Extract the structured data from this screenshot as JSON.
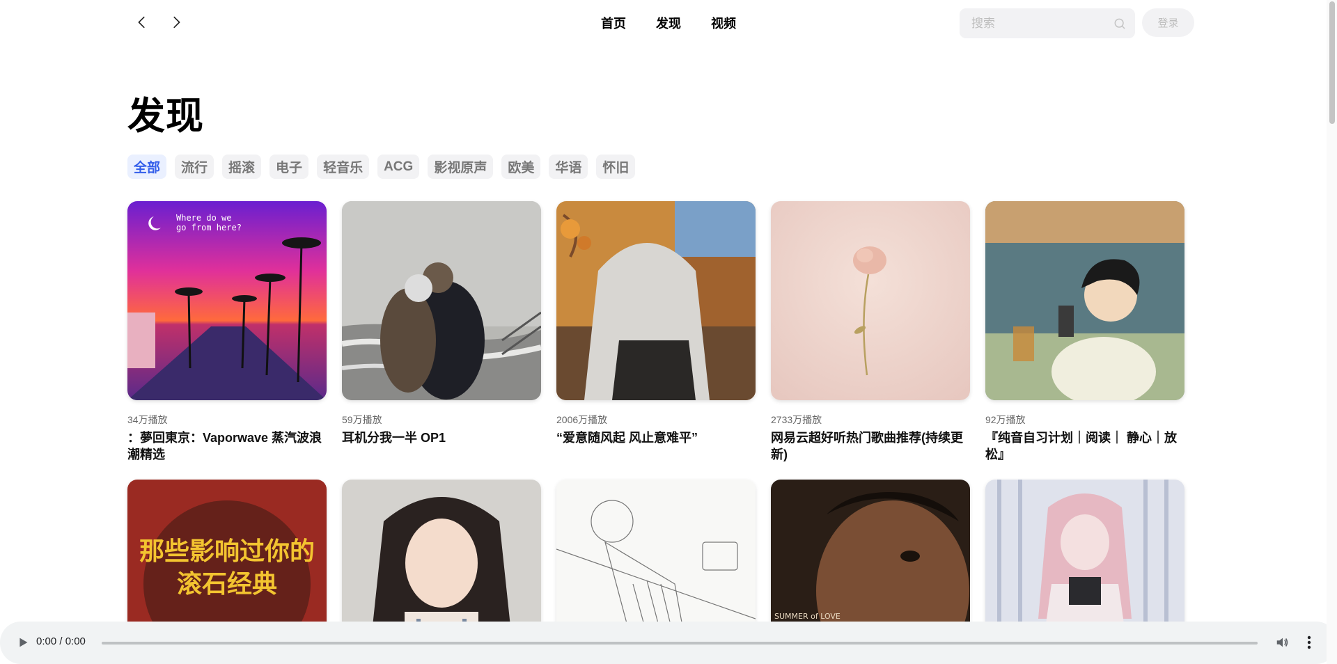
{
  "nav": {
    "back_icon": "chevron-left-icon",
    "forward_icon": "chevron-right-icon",
    "links": [
      "首页",
      "发现",
      "视频"
    ]
  },
  "search": {
    "placeholder": "搜索",
    "icon": "search-icon"
  },
  "login": {
    "label": "登录"
  },
  "title": "发现",
  "categories": [
    "全部",
    "流行",
    "摇滚",
    "电子",
    "轻音乐",
    "ACG",
    "影视原声",
    "欧美",
    "华语",
    "怀旧"
  ],
  "active_category": "全部",
  "playlists": [
    {
      "plays": "34万播放",
      "name": "：夢回東京：Vaporwave 蒸汽波浪潮精选",
      "cover_text": "Where do we go from here?"
    },
    {
      "plays": "59万播放",
      "name": "耳机分我一半 OP1"
    },
    {
      "plays": "2006万播放",
      "name": "“爱意随风起 风止意难平”"
    },
    {
      "plays": "2733万播放",
      "name": "网易云超好听热门歌曲推荐(持续更新)"
    },
    {
      "plays": "92万播放",
      "name": "『纯音自习计划｜阅读｜ 静心｜放松』"
    },
    {
      "plays": "",
      "name": "",
      "cover_text": "那些影响过你的滚石经典"
    },
    {
      "plays": "",
      "name": ""
    },
    {
      "plays": "",
      "name": ""
    },
    {
      "plays": "",
      "name": "",
      "cover_text": "SUMMER of LOVE"
    },
    {
      "plays": "",
      "name": ""
    }
  ],
  "player": {
    "time": "0:00 / 0:00",
    "progress": 0
  },
  "colors": {
    "accent": "#335eea",
    "chip_bg": "#f2f2f4",
    "player_bg": "#f1f3f4"
  }
}
